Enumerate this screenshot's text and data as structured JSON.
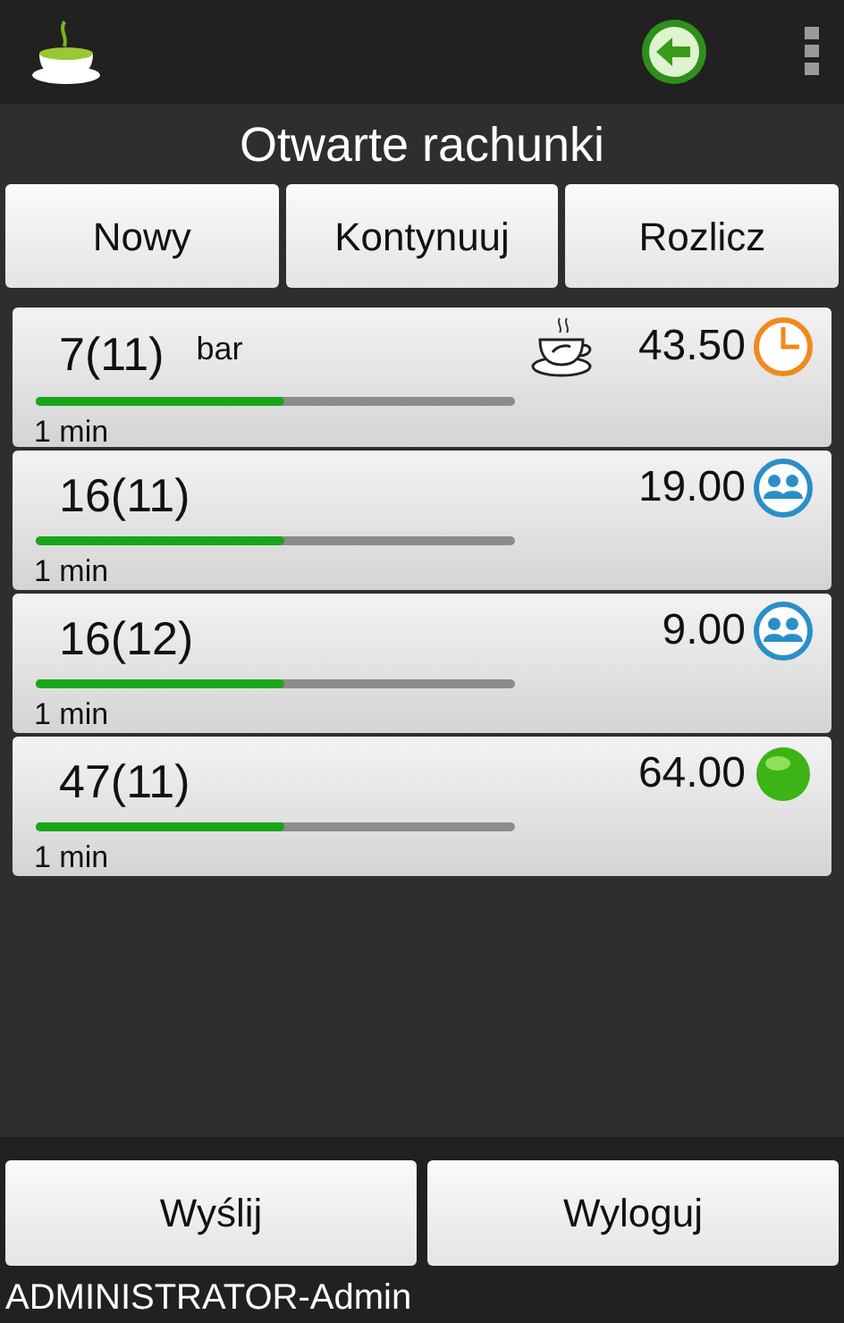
{
  "title": "Otwarte rachunki",
  "actions": [
    "Nowy",
    "Kontynuuj",
    "Rozlicz"
  ],
  "bills": [
    {
      "label": "7(11)",
      "tag": "bar",
      "served": true,
      "amount": "43.50",
      "kind": "clock",
      "level": 0.52,
      "time": "1 min"
    },
    {
      "label": "16(11)",
      "served": false,
      "amount": "19.00",
      "kind": "group",
      "level": 0.52,
      "time": "1 min"
    },
    {
      "label": "16(12)",
      "served": false,
      "amount": "9.00",
      "kind": "group",
      "level": 0.52,
      "time": "1 min"
    },
    {
      "label": "47(11)",
      "served": false,
      "amount": "64.00",
      "kind": "dot",
      "level": 0.52,
      "time": "1 min"
    }
  ],
  "footer_buttons": [
    "Wyślij",
    "Wyloguj"
  ],
  "user": "ADMINISTRATOR-Admin"
}
